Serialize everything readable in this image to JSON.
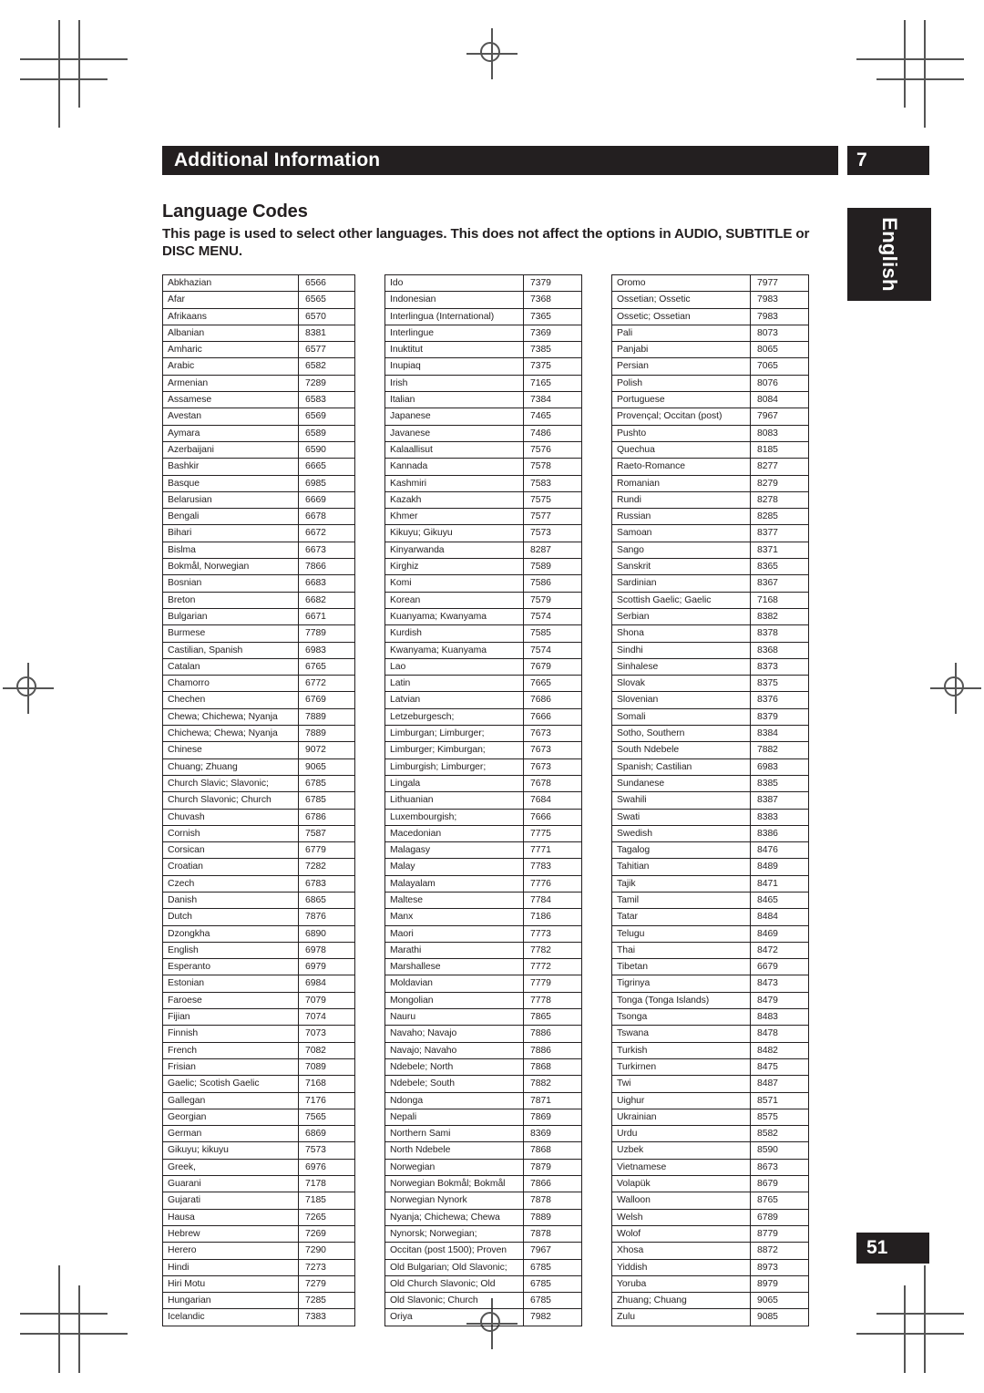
{
  "header": {
    "chapter_title": "Additional Information",
    "chapter_number": "7"
  },
  "side_tab": {
    "label": "English"
  },
  "footer": {
    "page_number": "51"
  },
  "section": {
    "title": "Language Codes",
    "intro": "This page is used to select other languages. This does not affect the options in AUDIO, SUBTITLE or DISC MENU."
  },
  "colors": {
    "ink": "#231f20",
    "paper": "#ffffff",
    "mark": "#555555"
  },
  "table": {
    "columns": [
      {
        "name": "column-1",
        "rows": [
          [
            "Abkhazian",
            "6566"
          ],
          [
            "Afar",
            "6565"
          ],
          [
            "Afrikaans",
            "6570"
          ],
          [
            "Albanian",
            "8381"
          ],
          [
            "Amharic",
            "6577"
          ],
          [
            "Arabic",
            "6582"
          ],
          [
            "Armenian",
            "7289"
          ],
          [
            "Assamese",
            "6583"
          ],
          [
            "Avestan",
            "6569"
          ],
          [
            "Aymara",
            "6589"
          ],
          [
            "Azerbaijani",
            "6590"
          ],
          [
            "Bashkir",
            "6665"
          ],
          [
            "Basque",
            "6985"
          ],
          [
            "Belarusian",
            "6669"
          ],
          [
            "Bengali",
            "6678"
          ],
          [
            "Bihari",
            "6672"
          ],
          [
            "Bislma",
            "6673"
          ],
          [
            "Bokmål, Norwegian",
            "7866"
          ],
          [
            "Bosnian",
            "6683"
          ],
          [
            "Breton",
            "6682"
          ],
          [
            "Bulgarian",
            "6671"
          ],
          [
            "Burmese",
            "7789"
          ],
          [
            "Castilian, Spanish",
            "6983"
          ],
          [
            "Catalan",
            "6765"
          ],
          [
            "Chamorro",
            "6772"
          ],
          [
            "Chechen",
            "6769"
          ],
          [
            "Chewa; Chichewa; Nyanja",
            "7889"
          ],
          [
            "Chichewa; Chewa; Nyanja",
            "7889"
          ],
          [
            "Chinese",
            "9072"
          ],
          [
            "Chuang; Zhuang",
            "9065"
          ],
          [
            "Church Slavic; Slavonic;",
            "6785"
          ],
          [
            "Church Slavonic; Church",
            "6785"
          ],
          [
            "Chuvash",
            "6786"
          ],
          [
            "Cornish",
            "7587"
          ],
          [
            "Corsican",
            "6779"
          ],
          [
            "Croatian",
            "7282"
          ],
          [
            "Czech",
            "6783"
          ],
          [
            "Danish",
            "6865"
          ],
          [
            "Dutch",
            "7876"
          ],
          [
            "Dzongkha",
            "6890"
          ],
          [
            "English",
            "6978"
          ],
          [
            "Esperanto",
            "6979"
          ],
          [
            "Estonian",
            "6984"
          ],
          [
            "Faroese",
            "7079"
          ],
          [
            "Fijian",
            "7074"
          ],
          [
            "Finnish",
            "7073"
          ],
          [
            "French",
            "7082"
          ],
          [
            "Frisian",
            "7089"
          ],
          [
            "Gaelic; Scotish Gaelic",
            "7168"
          ],
          [
            "Gallegan",
            "7176"
          ],
          [
            "Georgian",
            "7565"
          ],
          [
            "German",
            "6869"
          ],
          [
            "Gikuyu; kikuyu",
            "7573"
          ],
          [
            "Greek,",
            "6976"
          ],
          [
            "Guarani",
            "7178"
          ],
          [
            "Gujarati",
            "7185"
          ],
          [
            "Hausa",
            "7265"
          ],
          [
            "Hebrew",
            "7269"
          ],
          [
            "Herero",
            "7290"
          ],
          [
            "Hindi",
            "7273"
          ],
          [
            "Hiri Motu",
            "7279"
          ],
          [
            "Hungarian",
            "7285"
          ],
          [
            "Icelandic",
            "7383"
          ]
        ]
      },
      {
        "name": "column-2",
        "rows": [
          [
            "Ido",
            "7379"
          ],
          [
            "Indonesian",
            "7368"
          ],
          [
            "Interlingua (International)",
            "7365"
          ],
          [
            "Interlingue",
            "7369"
          ],
          [
            "Inuktitut",
            "7385"
          ],
          [
            "Inupiaq",
            "7375"
          ],
          [
            "Irish",
            "7165"
          ],
          [
            "Italian",
            "7384"
          ],
          [
            "Japanese",
            "7465"
          ],
          [
            "Javanese",
            "7486"
          ],
          [
            "Kalaallisut",
            "7576"
          ],
          [
            "Kannada",
            "7578"
          ],
          [
            "Kashmiri",
            "7583"
          ],
          [
            "Kazakh",
            "7575"
          ],
          [
            "Khmer",
            "7577"
          ],
          [
            "Kikuyu; Gikuyu",
            "7573"
          ],
          [
            "Kinyarwanda",
            "8287"
          ],
          [
            "Kirghiz",
            "7589"
          ],
          [
            "Komi",
            "7586"
          ],
          [
            "Korean",
            "7579"
          ],
          [
            "Kuanyama; Kwanyama",
            "7574"
          ],
          [
            "Kurdish",
            "7585"
          ],
          [
            "Kwanyama; Kuanyama",
            "7574"
          ],
          [
            "Lao",
            "7679"
          ],
          [
            "Latin",
            "7665"
          ],
          [
            "Latvian",
            "7686"
          ],
          [
            "Letzeburgesch;",
            "7666"
          ],
          [
            "Limburgan; Limburger;",
            "7673"
          ],
          [
            "Limburger; Kimburgan;",
            "7673"
          ],
          [
            "Limburgish; Limburger;",
            "7673"
          ],
          [
            "Lingala",
            "7678"
          ],
          [
            "Lithuanian",
            "7684"
          ],
          [
            "Luxembourgish;",
            "7666"
          ],
          [
            "Macedonian",
            "7775"
          ],
          [
            "Malagasy",
            "7771"
          ],
          [
            "Malay",
            "7783"
          ],
          [
            "Malayalam",
            "7776"
          ],
          [
            "Maltese",
            "7784"
          ],
          [
            "Manx",
            "7186"
          ],
          [
            "Maori",
            "7773"
          ],
          [
            "Marathi",
            "7782"
          ],
          [
            "Marshallese",
            "7772"
          ],
          [
            "Moldavian",
            "7779"
          ],
          [
            "Mongolian",
            "7778"
          ],
          [
            "Nauru",
            "7865"
          ],
          [
            "Navaho; Navajo",
            "7886"
          ],
          [
            "Navajo; Navaho",
            "7886"
          ],
          [
            "Ndebele; North",
            "7868"
          ],
          [
            "Ndebele; South",
            "7882"
          ],
          [
            "Ndonga",
            "7871"
          ],
          [
            "Nepali",
            "7869"
          ],
          [
            "Northern Sami",
            "8369"
          ],
          [
            "North Ndebele",
            "7868"
          ],
          [
            "Norwegian",
            "7879"
          ],
          [
            "Norwegian Bokmål; Bokmål",
            "7866"
          ],
          [
            "Norwegian Nynork",
            "7878"
          ],
          [
            "Nyanja; Chichewa; Chewa",
            "7889"
          ],
          [
            "Nynorsk; Norwegian;",
            "7878"
          ],
          [
            "Occitan (post 1500); Proven",
            "7967"
          ],
          [
            "Old Bulgarian; Old Slavonic;",
            "6785"
          ],
          [
            "Old Church Slavonic; Old",
            "6785"
          ],
          [
            "Old Slavonic; Church",
            "6785"
          ],
          [
            "Oriya",
            "7982"
          ]
        ]
      },
      {
        "name": "column-3",
        "rows": [
          [
            "Oromo",
            "7977"
          ],
          [
            "Ossetian; Ossetic",
            "7983"
          ],
          [
            "Ossetic; Ossetian",
            "7983"
          ],
          [
            "Pali",
            "8073"
          ],
          [
            "Panjabi",
            "8065"
          ],
          [
            "Persian",
            "7065"
          ],
          [
            "Polish",
            "8076"
          ],
          [
            "Portuguese",
            "8084"
          ],
          [
            "Provençal; Occitan (post)",
            "7967"
          ],
          [
            "Pushto",
            "8083"
          ],
          [
            "Quechua",
            "8185"
          ],
          [
            "Raeto-Romance",
            "8277"
          ],
          [
            "Romanian",
            "8279"
          ],
          [
            "Rundi",
            "8278"
          ],
          [
            "Russian",
            "8285"
          ],
          [
            "Samoan",
            "8377"
          ],
          [
            "Sango",
            "8371"
          ],
          [
            "Sanskrit",
            "8365"
          ],
          [
            "Sardinian",
            "8367"
          ],
          [
            "Scottish Gaelic; Gaelic",
            "7168"
          ],
          [
            "Serbian",
            "8382"
          ],
          [
            "Shona",
            "8378"
          ],
          [
            "Sindhi",
            "8368"
          ],
          [
            "Sinhalese",
            "8373"
          ],
          [
            "Slovak",
            "8375"
          ],
          [
            "Slovenian",
            "8376"
          ],
          [
            "Somali",
            "8379"
          ],
          [
            "Sotho, Southern",
            "8384"
          ],
          [
            "South Ndebele",
            "7882"
          ],
          [
            "Spanish; Castilian",
            "6983"
          ],
          [
            "Sundanese",
            "8385"
          ],
          [
            "Swahili",
            "8387"
          ],
          [
            "Swati",
            "8383"
          ],
          [
            "Swedish",
            "8386"
          ],
          [
            "Tagalog",
            "8476"
          ],
          [
            "Tahitian",
            "8489"
          ],
          [
            "Tajik",
            "8471"
          ],
          [
            "Tamil",
            "8465"
          ],
          [
            "Tatar",
            "8484"
          ],
          [
            "Telugu",
            "8469"
          ],
          [
            "Thai",
            "8472"
          ],
          [
            "Tibetan",
            "6679"
          ],
          [
            "Tigrinya",
            "8473"
          ],
          [
            "Tonga (Tonga Islands)",
            "8479"
          ],
          [
            "Tsonga",
            "8483"
          ],
          [
            "Tswana",
            "8478"
          ],
          [
            "Turkish",
            "8482"
          ],
          [
            "Turkirnen",
            "8475"
          ],
          [
            "Twi",
            "8487"
          ],
          [
            "Uighur",
            "8571"
          ],
          [
            "Ukrainian",
            "8575"
          ],
          [
            "Urdu",
            "8582"
          ],
          [
            "Uzbek",
            "8590"
          ],
          [
            "Vietnamese",
            "8673"
          ],
          [
            "Volapük",
            "8679"
          ],
          [
            "Walloon",
            "8765"
          ],
          [
            "Welsh",
            "6789"
          ],
          [
            "Wolof",
            "8779"
          ],
          [
            "Xhosa",
            "8872"
          ],
          [
            "Yiddish",
            "8973"
          ],
          [
            "Yoruba",
            "8979"
          ],
          [
            "Zhuang; Chuang",
            "9065"
          ],
          [
            "Zulu",
            "9085"
          ]
        ]
      }
    ]
  }
}
